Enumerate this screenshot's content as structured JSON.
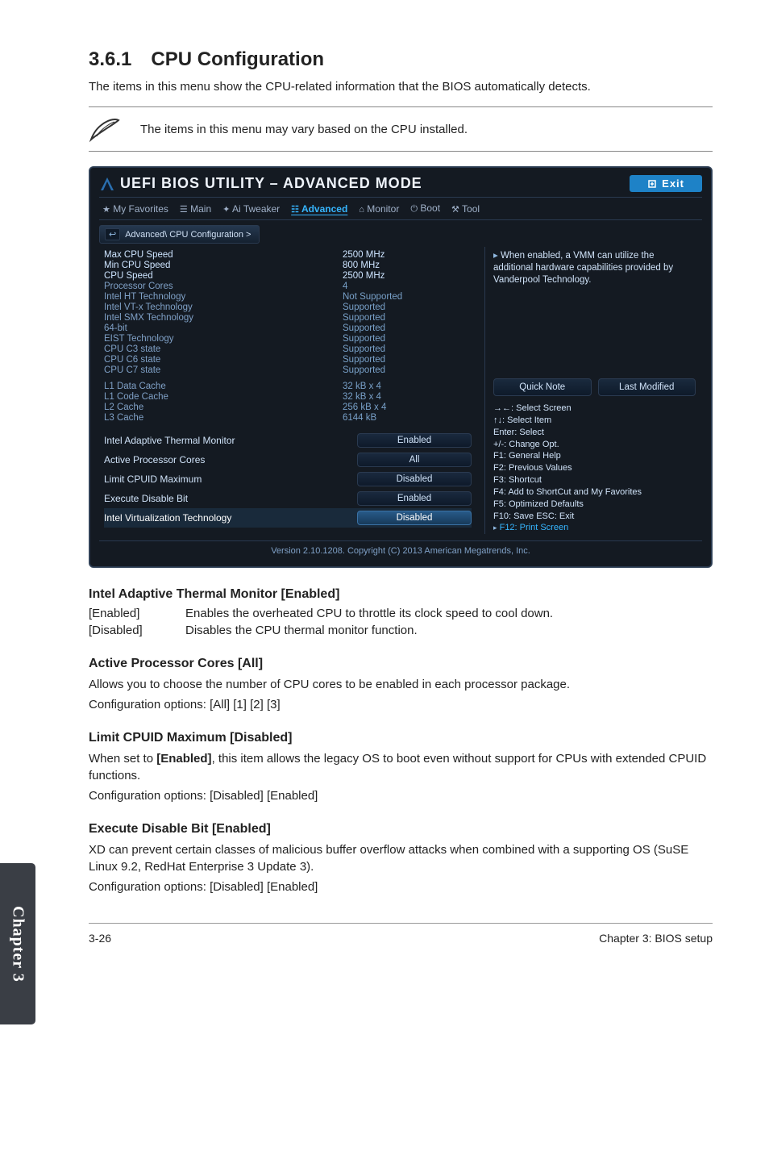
{
  "section_number": "3.6.1",
  "section_title": "CPU Configuration",
  "section_subtitle": "The items in this menu show the CPU-related information that the BIOS automatically detects.",
  "note_text": "The items in this menu may vary based on the CPU installed.",
  "bios": {
    "title": "UEFI BIOS UTILITY – ADVANCED MODE",
    "exit": "Exit",
    "tabs": [
      "My Favorites",
      "Main",
      "Ai Tweaker",
      "Advanced",
      "Monitor",
      "Boot",
      "Tool"
    ],
    "tabs_icons": [
      "★",
      "☰",
      "⚙",
      "↳",
      "⌂",
      "⏻",
      "⚒"
    ],
    "selected_tab": "Advanced",
    "breadcrumb": "Advanced\\ CPU Configuration >",
    "help_text": "When enabled, a VMM can utilize the additional hardware capabilities provided by Vanderpool Technology.",
    "info": [
      {
        "label": "Max CPU Speed",
        "value": "2500 MHz",
        "group": "blue"
      },
      {
        "label": "Min CPU Speed",
        "value": "800 MHz",
        "group": "blue"
      },
      {
        "label": "CPU Speed",
        "value": "2500 MHz",
        "group": "blue"
      },
      {
        "label": "Processor Cores",
        "value": "4",
        "group": "gray"
      },
      {
        "label": "Intel HT Technology",
        "value": "Not Supported",
        "group": "gray"
      },
      {
        "label": "Intel VT-x Technology",
        "value": "Supported",
        "group": "gray"
      },
      {
        "label": "Intel SMX Technology",
        "value": "Supported",
        "group": "gray"
      },
      {
        "label": "64-bit",
        "value": "Supported",
        "group": "gray"
      },
      {
        "label": "EIST Technology",
        "value": "Supported",
        "group": "gray"
      },
      {
        "label": "CPU C3 state",
        "value": "Supported",
        "group": "gray"
      },
      {
        "label": "CPU C6 state",
        "value": "Supported",
        "group": "gray"
      },
      {
        "label": "CPU C7 state",
        "value": "Supported",
        "group": "gray"
      }
    ],
    "cache": [
      {
        "label": "L1 Data Cache",
        "value": "32 kB x 4"
      },
      {
        "label": "L1 Code Cache",
        "value": "32 kB x 4"
      },
      {
        "label": "L2 Cache",
        "value": "256 kB x 4"
      },
      {
        "label": "L3 Cache",
        "value": "6144 kB"
      }
    ],
    "settings": [
      {
        "label": "Intel Adaptive Thermal Monitor",
        "value": "Enabled"
      },
      {
        "label": "Active Processor Cores",
        "value": "All"
      },
      {
        "label": "Limit CPUID Maximum",
        "value": "Disabled"
      },
      {
        "label": "Execute Disable Bit",
        "value": "Enabled"
      },
      {
        "label": "Intel Virtualization Technology",
        "value": "Disabled",
        "selected": true
      }
    ],
    "quick_note_btn": "Quick Note",
    "last_mod_btn": "Last Modified",
    "keys": [
      "→←: Select Screen",
      "↑↓: Select Item",
      "Enter: Select",
      "+/-: Change Opt.",
      "F1: General Help",
      "F2: Previous Values",
      "F3: Shortcut",
      "F4: Add to ShortCut and My Favorites",
      "F5: Optimized Defaults",
      "F10: Save  ESC: Exit",
      "F12: Print Screen"
    ],
    "version": "Version 2.10.1208. Copyright (C) 2013 American Megatrends, Inc."
  },
  "options": [
    {
      "title": "Intel Adaptive Thermal Monitor [Enabled]",
      "rows": [
        {
          "k": "[Enabled]",
          "v": "Enables the overheated CPU to throttle its clock speed to cool down."
        },
        {
          "k": "[Disabled]",
          "v": "Disables the CPU thermal monitor function."
        }
      ]
    }
  ],
  "apc": {
    "title": "Active Processor Cores [All]",
    "desc": "Allows you to choose the number of CPU cores to be enabled in each processor package.",
    "cfg": "Configuration options: [All] [1] [2] [3]"
  },
  "lcm": {
    "title": "Limit CPUID Maximum [Disabled]",
    "desc_pre": "When set to ",
    "desc_bold": "[Enabled]",
    "desc_post": ", this item allows the legacy OS to boot even without support for CPUs with extended CPUID functions.",
    "cfg": "Configuration options: [Disabled] [Enabled]"
  },
  "edb": {
    "title": "Execute Disable Bit [Enabled]",
    "desc": "XD can prevent certain classes of malicious buffer overflow attacks when combined with a supporting OS (SuSE Linux 9.2, RedHat Enterprise 3 Update 3).",
    "cfg": "Configuration options: [Disabled] [Enabled]"
  },
  "chapter_tab": "Chapter 3",
  "footer_left": "3-26",
  "footer_right": "Chapter 3: BIOS setup"
}
